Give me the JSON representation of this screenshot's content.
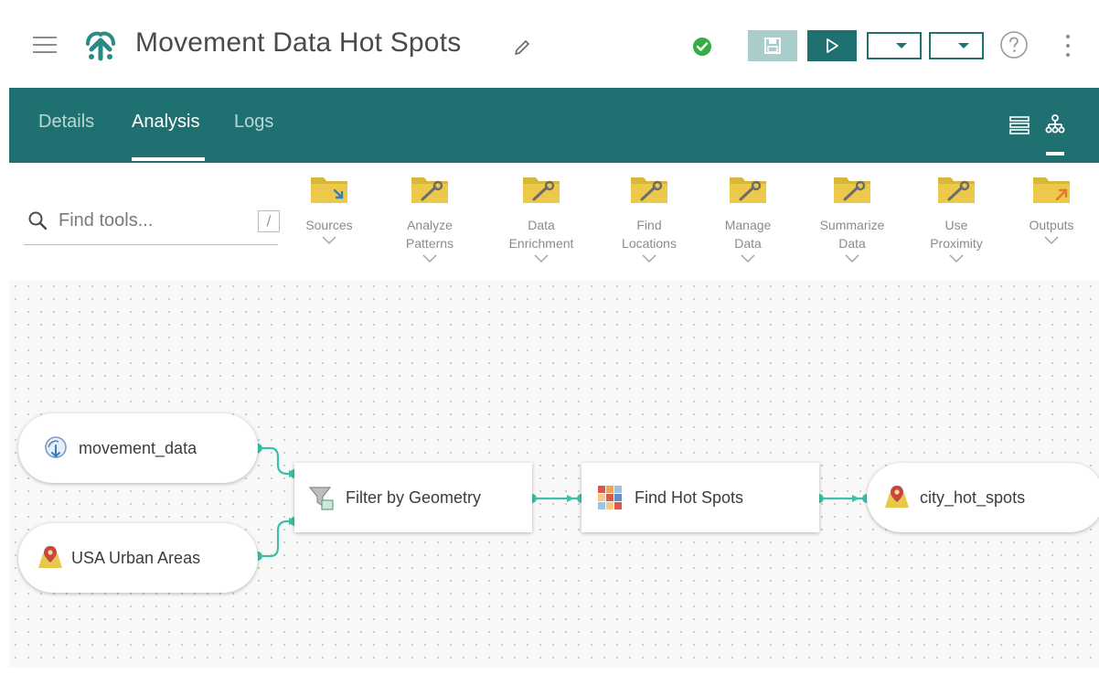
{
  "header": {
    "title": "Movement Data Hot Spots",
    "brand_color": "#1e7170",
    "status_color": "#35ac46"
  },
  "tabs": [
    {
      "label": "Details",
      "active": false
    },
    {
      "label": "Analysis",
      "active": true
    },
    {
      "label": "Logs",
      "active": false
    }
  ],
  "search": {
    "placeholder": "Find tools...",
    "shortcut": "/"
  },
  "categories": [
    {
      "line1": "Sources",
      "line2": ""
    },
    {
      "line1": "Analyze",
      "line2": "Patterns"
    },
    {
      "line1": "Data",
      "line2": "Enrichment"
    },
    {
      "line1": "Find",
      "line2": "Locations"
    },
    {
      "line1": "Manage",
      "line2": "Data"
    },
    {
      "line1": "Summarize",
      "line2": "Data"
    },
    {
      "line1": "Use",
      "line2": "Proximity"
    },
    {
      "line1": "Outputs",
      "line2": ""
    }
  ],
  "nodes": {
    "movement_data": "movement_data",
    "usa_urban_areas": "USA Urban Areas",
    "filter_by_geometry": "Filter by Geometry",
    "find_hot_spots": "Find Hot Spots",
    "city_hot_spots": "city_hot_spots"
  },
  "icons": {
    "menu": "hamburger-icon",
    "logo": "app-logo-icon",
    "edit": "pencil-icon",
    "status": "check-circle-icon",
    "save": "save-icon",
    "run": "play-icon",
    "help": "help-icon",
    "more": "kebab-icon",
    "list_view": "list-view-icon",
    "tree_view": "tree-view-icon",
    "folder": "folder-icon"
  }
}
